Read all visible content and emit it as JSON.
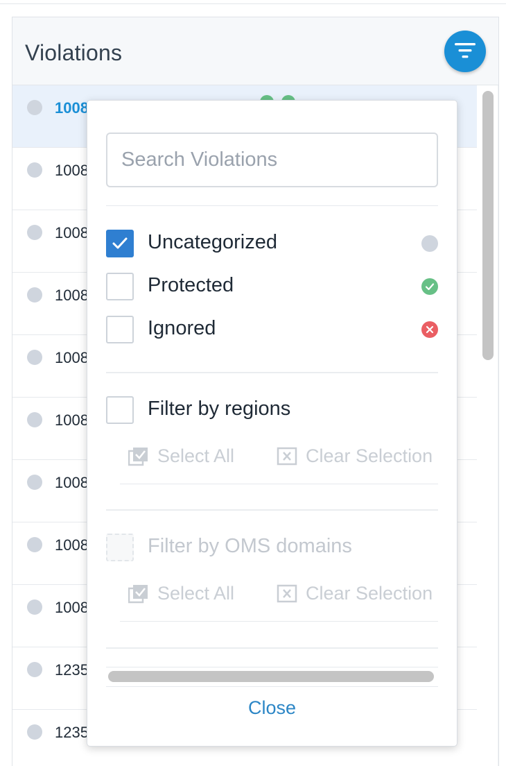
{
  "panel": {
    "title": "Violations",
    "filter_button_icon": "filter-icon"
  },
  "rows": [
    {
      "id": "1008",
      "selected": true
    },
    {
      "id": "1008"
    },
    {
      "id": "1008"
    },
    {
      "id": "1008"
    },
    {
      "id": "1008"
    },
    {
      "id": "1008"
    },
    {
      "id": "1008"
    },
    {
      "id": "1008"
    },
    {
      "id": "1008"
    },
    {
      "id": "1235"
    },
    {
      "id": "1235"
    }
  ],
  "filter": {
    "search_placeholder": "Search Violations",
    "statuses": [
      {
        "label": "Uncategorized",
        "checked": true,
        "icon": "uncategorized-icon",
        "color": "#cfd5de"
      },
      {
        "label": "Protected",
        "checked": false,
        "icon": "check-circle-icon",
        "color": "#67c086"
      },
      {
        "label": "Ignored",
        "checked": false,
        "icon": "x-circle-icon",
        "color": "#ea5e63"
      }
    ],
    "regions": {
      "label": "Filter by regions",
      "checked": false,
      "select_all": "Select All",
      "clear_selection": "Clear Selection"
    },
    "oms_domains": {
      "label": "Filter by OMS domains",
      "checked": false,
      "disabled": true,
      "select_all": "Select All",
      "clear_selection": "Clear Selection"
    },
    "close_label": "Close"
  },
  "colors": {
    "accent": "#1a8fd6",
    "checkbox_checked": "#2f7fd1",
    "protected": "#67c086",
    "ignored": "#ea5e63",
    "link": "#2c86c6"
  }
}
